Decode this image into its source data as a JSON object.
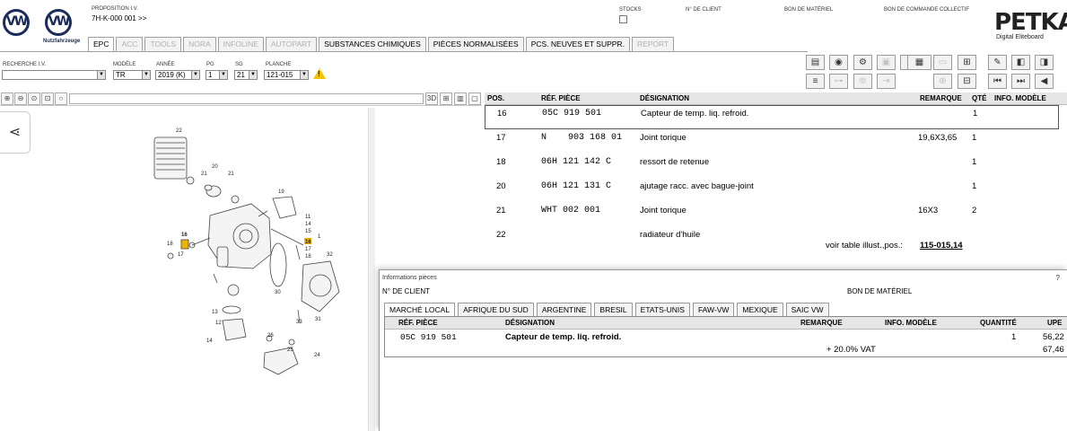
{
  "header": {
    "logo_text": "VW",
    "logo_sub": "Nutzfahrzeuge",
    "proposition_label": "PROPOSITION I.V.",
    "proposition_value": "7H-K-000 001 >>",
    "stocks_label": "STOCKS",
    "client_label": "N° DE CLIENT",
    "bom_label": "BON DE MATÉRIEL",
    "collective_order_label": "BON DE COMMANDE COLLECTIF",
    "petka_logo": "PETKA",
    "petka_sub": "Digital Eliteboard"
  },
  "tabs": [
    {
      "label": "EPC",
      "state": "active"
    },
    {
      "label": "ACC",
      "state": "disabled"
    },
    {
      "label": "TOOLS",
      "state": "disabled"
    },
    {
      "label": "NORA",
      "state": "disabled"
    },
    {
      "label": "INFOLINE",
      "state": "disabled"
    },
    {
      "label": "AUTOPART",
      "state": "disabled"
    },
    {
      "label": "SUBSTANCES CHIMIQUES",
      "state": "normal"
    },
    {
      "label": "PIÈCES NORMALISÉES",
      "state": "normal"
    },
    {
      "label": "PCS. NEUVES ET SUPPR.",
      "state": "normal"
    },
    {
      "label": "REPORT",
      "state": "disabled"
    }
  ],
  "selectors": {
    "search_label": "RECHERCHE I.V.",
    "search_value": "",
    "model_label": "MODÈLE",
    "model_value": "TR",
    "year_label": "ANNÉE",
    "year_value": "2019 (K)",
    "pg_label": "PG",
    "pg_value": "1",
    "sg_label": "SG",
    "sg_value": "21",
    "plate_label": "PLANCHE",
    "plate_value": "121-015",
    "warning_symbol": "!"
  },
  "toolbar_icons": {
    "row1": [
      "printer-icon",
      "scanner-icon",
      "car-icon",
      "image-icon",
      "unknown-icon",
      "elsa-icon",
      "basket-icon",
      "cart-icon",
      "pin-icon",
      "prev-plate-icon",
      "next-plate-icon"
    ],
    "row2": [
      "barcode-icon",
      "key-icon",
      "vehicle-icon",
      "arrows-icon",
      "settings-icon",
      "cart-add-icon",
      "cart-edit-icon",
      "first-icon",
      "previous-icon",
      "back-icon"
    ]
  },
  "illustration": {
    "toolbar_3d": "3D",
    "share_icon": "share-icon",
    "callouts": [
      "22",
      "20",
      "21",
      "21",
      "19",
      "16",
      "18",
      "17",
      "11",
      "14",
      "15",
      "16",
      "17",
      "18",
      "1",
      "32",
      "30",
      "31",
      "33",
      "13",
      "12",
      "14",
      "26",
      "25",
      "24"
    ],
    "highlight_color": "#f0b400"
  },
  "parts_table": {
    "headers": {
      "pos": "POS.",
      "ref": "RÉF. PIÈCE",
      "designation": "DÉSIGNATION",
      "remark": "REMARQUE",
      "qty": "QTÉ",
      "model_info": "INFO. MODÈLE"
    },
    "rows": [
      {
        "pos": "16",
        "ref": "05C 919 501",
        "designation": "Capteur de temp. liq. refroid.",
        "remark": "",
        "qty": "1",
        "selected": true
      },
      {
        "pos": "17",
        "ref": "N    903 168 01",
        "designation": "Joint torique",
        "remark": "19,6X3,65",
        "qty": "1",
        "selected": false
      },
      {
        "pos": "18",
        "ref": "06H 121 142 C",
        "designation": "ressort de retenue",
        "remark": "",
        "qty": "1",
        "selected": false
      },
      {
        "pos": "20",
        "ref": "06H 121 131 C",
        "designation": "ajutage racc. avec bague-joint",
        "remark": "",
        "qty": "1",
        "selected": false
      },
      {
        "pos": "21",
        "ref": "WHT 002 001",
        "designation": "Joint torique",
        "remark": "16X3",
        "qty": "2",
        "selected": false
      },
      {
        "pos": "22",
        "ref": "",
        "designation": "radiateur d'huile",
        "remark": "",
        "qty": "",
        "selected": false,
        "see_text": "voir table illust.,pos.:",
        "see_link": "115-015,14"
      }
    ]
  },
  "info_dialog": {
    "title": "Informations pièces",
    "close": "?",
    "client_label": "N° DE CLIENT",
    "bom_label": "BON DE MATÉRIEL",
    "tabs": [
      {
        "label": "MARCHÉ LOCAL",
        "active": true
      },
      {
        "label": "AFRIQUE DU SUD",
        "active": false
      },
      {
        "label": "ARGENTINE",
        "active": false
      },
      {
        "label": "BRESIL",
        "active": false
      },
      {
        "label": "ETATS-UNIS",
        "active": false
      },
      {
        "label": "FAW-VW",
        "active": false
      },
      {
        "label": "MEXIQUE",
        "active": false
      },
      {
        "label": "SAIC VW",
        "active": false
      }
    ],
    "headers": {
      "ref": "RÉF. PIÈCE",
      "designation": "DÉSIGNATION",
      "remark": "REMARQUE",
      "model_info": "INFO. MODÈLE",
      "quantity": "QUANTITÉ",
      "upe": "UPE"
    },
    "row": {
      "ref": "05C 919 501",
      "designation": "Capteur de temp. liq. refroid.",
      "quantity": "1",
      "upe": "56,22"
    },
    "vat_label": "+ 20.0% VAT",
    "vat_total": "67,46"
  }
}
